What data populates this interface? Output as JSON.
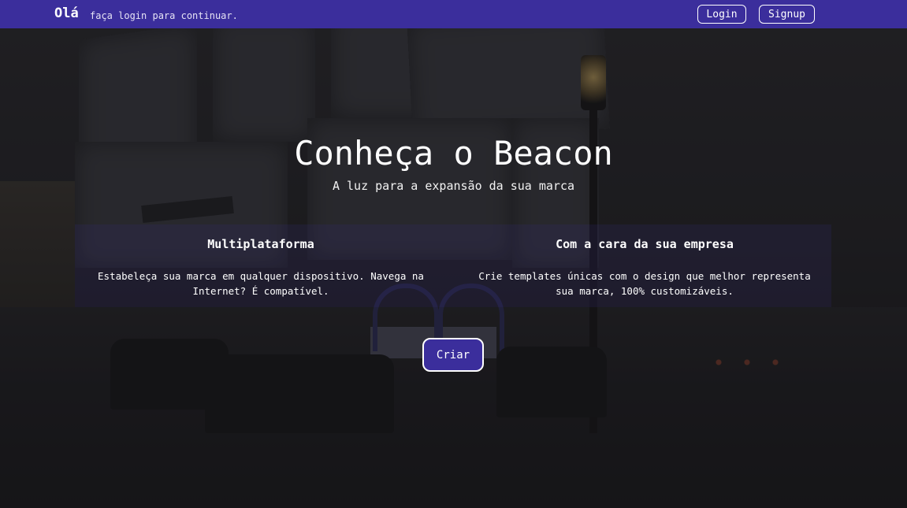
{
  "navbar": {
    "brand": "Olá",
    "subtitle": "faça login para continuar.",
    "login_label": "Login",
    "signup_label": "Signup"
  },
  "hero": {
    "title": "Conheça o Beacon",
    "subtitle": "A luz para a expansão da sua marca"
  },
  "features": [
    {
      "title": "Multiplataforma",
      "text": "Estabeleça sua marca em qualquer dispositivo. Navega na Internet? É compatível."
    },
    {
      "title": "Com a cara da sua empresa",
      "text": "Crie templates únicas com o design que melhor representa sua marca, 100% customizáveis."
    }
  ],
  "cta": {
    "label": "Criar"
  },
  "colors": {
    "accent": "#3b2e9c",
    "background": "#1c1b1e",
    "text": "#ffffff"
  }
}
